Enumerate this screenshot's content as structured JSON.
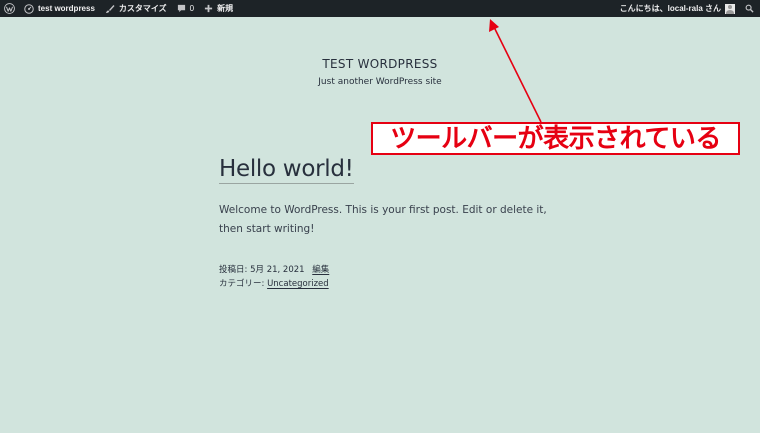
{
  "admin_bar": {
    "site_name": "test wordpress",
    "customize_label": "カスタマイズ",
    "comments_count": "0",
    "new_label": "新規",
    "greeting": "こんにちは、local-rala さん",
    "icons": [
      "wordpress-logo-icon",
      "dashboard-icon",
      "brush-icon",
      "comment-icon",
      "plus-icon",
      "avatar",
      "search-icon"
    ]
  },
  "site": {
    "title": "TEST WORDPRESS",
    "description": "Just another WordPress site"
  },
  "post": {
    "title": "Hello world!",
    "body": "Welcome to WordPress. This is your first post. Edit or delete it, then start writing!",
    "posted_label": "投稿日: ",
    "posted_date": "5月 21, 2021",
    "edit_link": "編集",
    "category_label": "カテゴリー: ",
    "category_link": "Uncategorized"
  },
  "annotation": {
    "text": "ツールバーが表示されている",
    "color": "#e60012"
  },
  "colors": {
    "background": "#d1e4dd",
    "admin_bar": "#1d2327",
    "text": "#28303d"
  }
}
